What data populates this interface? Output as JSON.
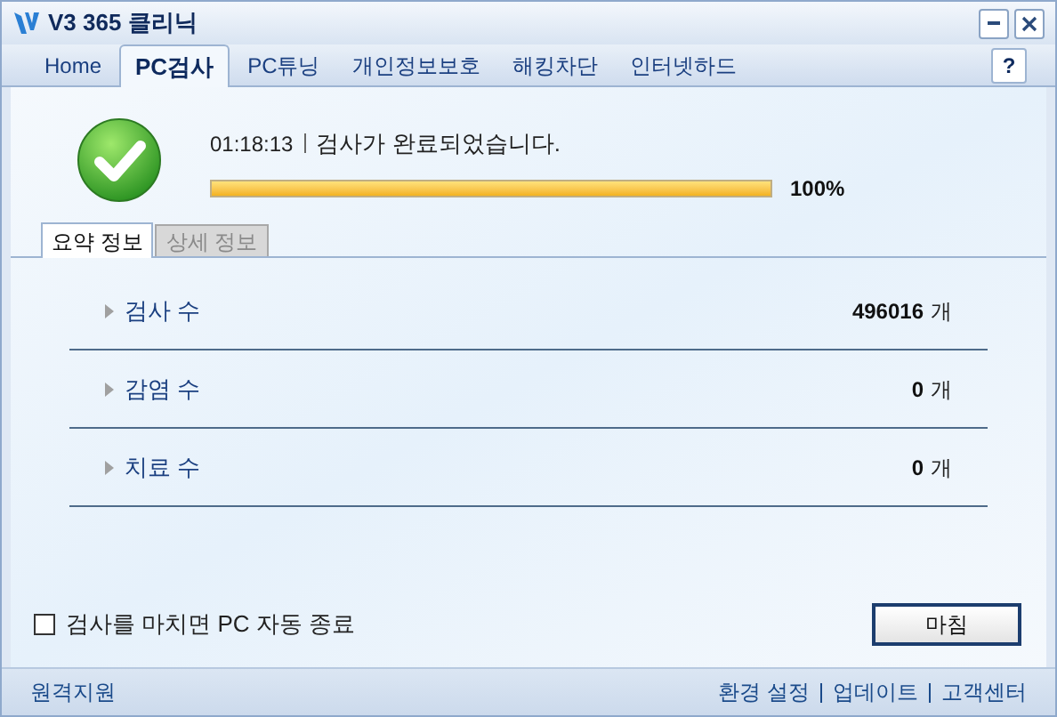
{
  "window": {
    "title": "V3 365 클리닉"
  },
  "tabs": [
    {
      "label": "Home",
      "selected": false
    },
    {
      "label": "PC검사",
      "selected": true
    },
    {
      "label": "PC튜닝",
      "selected": false
    },
    {
      "label": "개인정보보호",
      "selected": false
    },
    {
      "label": "해킹차단",
      "selected": false
    },
    {
      "label": "인터넷하드",
      "selected": false
    }
  ],
  "help_button": "?",
  "status": {
    "time": "01:18:13",
    "message": "검사가 완료되었습니다.",
    "level": 1,
    "percent": "100%"
  },
  "sub_tabs": [
    {
      "label": "요약 정보",
      "selected": true
    },
    {
      "label": "상세 정보",
      "selected": false
    }
  ],
  "summary_rows": [
    {
      "label": "검사 수",
      "value": "496016",
      "unit": "개"
    },
    {
      "label": "감염 수",
      "value": "0",
      "unit": "개"
    },
    {
      "label": "치료 수",
      "value": "0",
      "unit": "개"
    }
  ],
  "auto_shutdown": {
    "label": "검사를 마치면 PC 자동 종료",
    "checked": false
  },
  "finish_button": "마침",
  "footer": {
    "left_link": "원격지원",
    "right_links": [
      "환경 설정",
      "업데이트",
      "고객센터"
    ]
  }
}
